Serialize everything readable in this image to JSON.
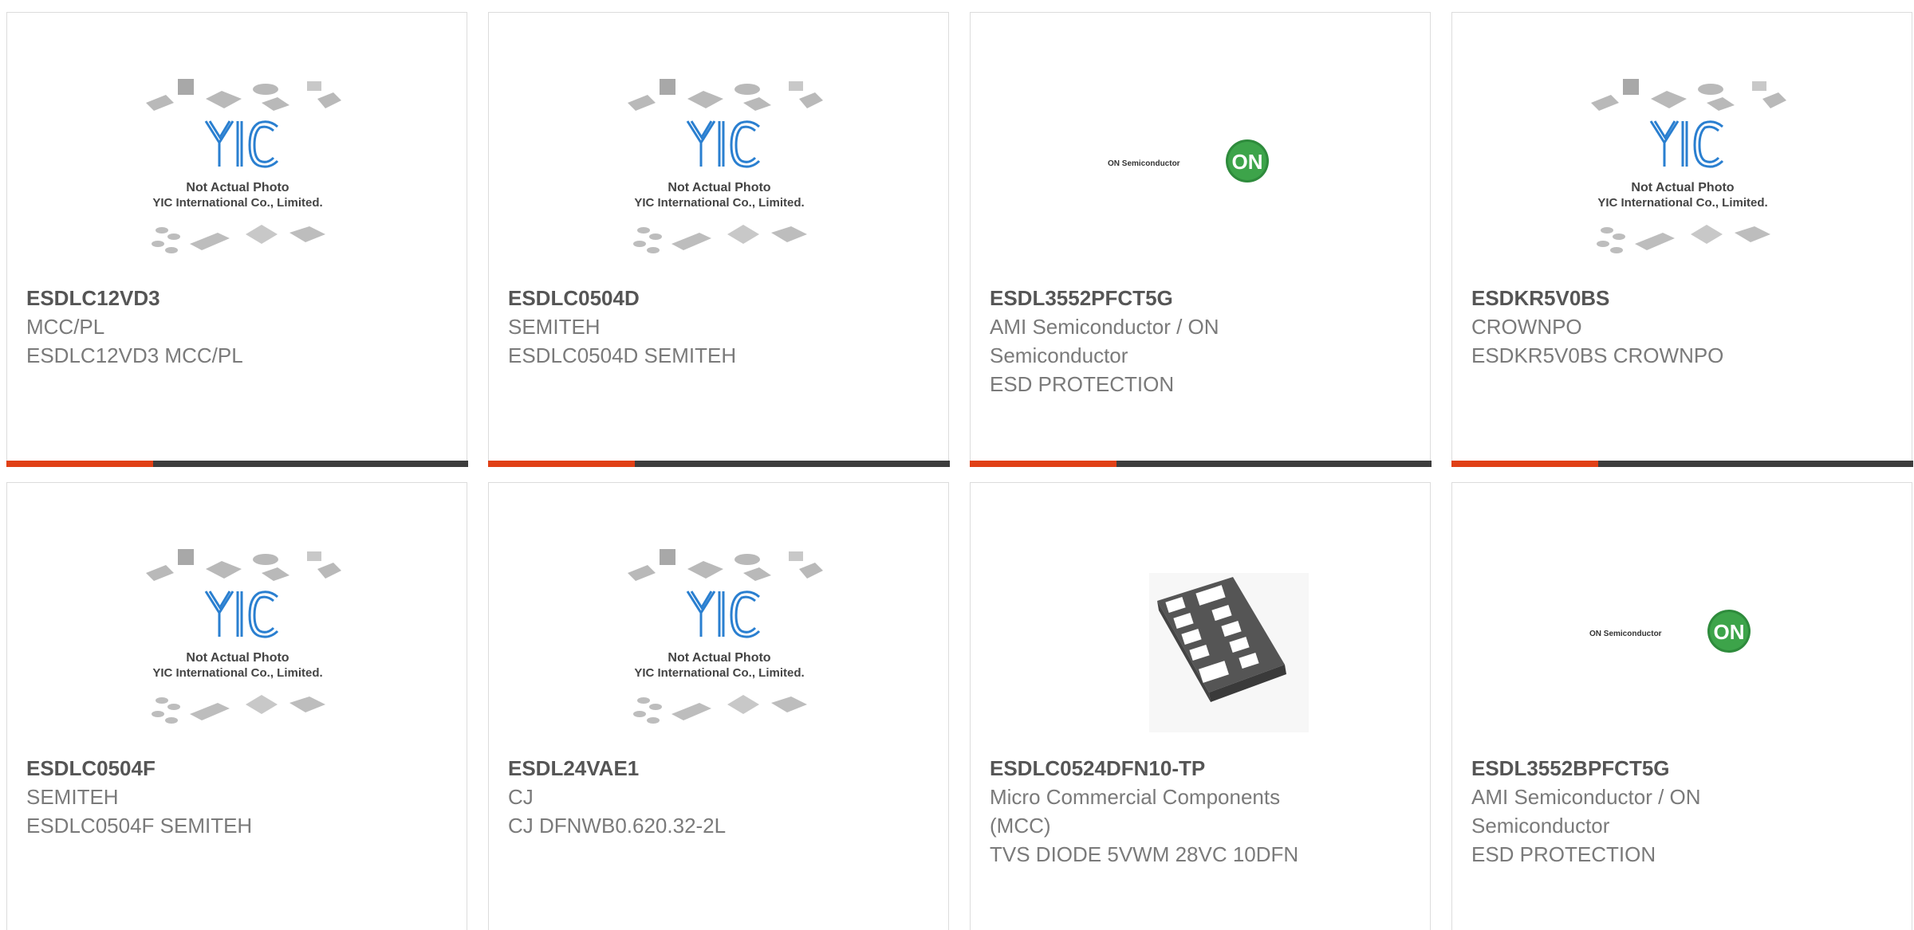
{
  "colors": {
    "accent": "#e04016",
    "bar": "#3d3d3d",
    "yic_blue": "#2a7fd0",
    "on_green": "#2e8b3c"
  },
  "placeholder": {
    "line1": "Not Actual Photo",
    "line2": "YIC International Co., Limited.",
    "logo": "YIC"
  },
  "onsemi": {
    "text": "ON Semiconductor",
    "badge": "ON"
  },
  "products": [
    {
      "part": "ESDLC12VD3",
      "lines": [
        "MCC/PL",
        "ESDLC12VD3 MCC/PL"
      ],
      "image": "yic-placeholder"
    },
    {
      "part": "ESDLC0504D",
      "lines": [
        "SEMITEH",
        "ESDLC0504D SEMITEH"
      ],
      "image": "yic-placeholder"
    },
    {
      "part": "ESDL3552PFCT5G",
      "lines": [
        "AMI Semiconductor / ON",
        "Semiconductor",
        "ESD PROTECTION"
      ],
      "image": "on-semi-logo"
    },
    {
      "part": "ESDKR5V0BS",
      "lines": [
        "CROWNPO",
        "ESDKR5V0BS CROWNPO"
      ],
      "image": "yic-placeholder"
    },
    {
      "part": "ESDLC0504F",
      "lines": [
        "SEMITEH",
        "ESDLC0504F SEMITEH"
      ],
      "image": "yic-placeholder"
    },
    {
      "part": "ESDL24VAE1",
      "lines": [
        "CJ",
        "CJ DFNWB0.620.32-2L"
      ],
      "image": "yic-placeholder"
    },
    {
      "part": "ESDLC0524DFN10-TP",
      "lines": [
        "Micro Commercial Components",
        "(MCC)",
        "TVS DIODE 5VWM 28VC 10DFN"
      ],
      "image": "dfn-package-photo"
    },
    {
      "part": "ESDL3552BPFCT5G",
      "lines": [
        "AMI Semiconductor / ON",
        "Semiconductor",
        "ESD PROTECTION"
      ],
      "image": "on-semi-logo"
    }
  ]
}
